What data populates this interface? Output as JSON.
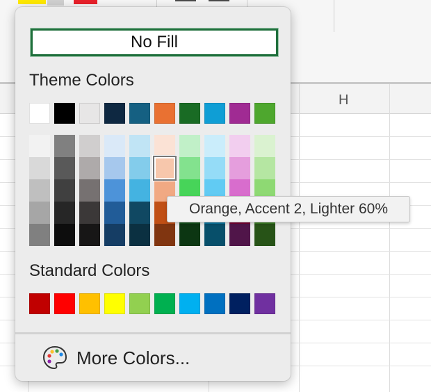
{
  "sheet": {
    "column_label": "H"
  },
  "popup": {
    "no_fill_label": "No Fill",
    "theme_title": "Theme Colors",
    "standard_title": "Standard Colors",
    "more_colors_label": "More Colors...",
    "theme_colors": [
      "#ffffff",
      "#000000",
      "#e7e6e6",
      "#0e2841",
      "#156082",
      "#e97132",
      "#196b24",
      "#0f9ed5",
      "#a02b93",
      "#4ea72e"
    ],
    "theme_tints": [
      [
        "#f2f2f2",
        "#d9d9d9",
        "#bfbfbf",
        "#a6a6a6",
        "#808080"
      ],
      [
        "#808080",
        "#595959",
        "#404040",
        "#262626",
        "#0d0d0d"
      ],
      [
        "#d0cece",
        "#aeaaaa",
        "#767171",
        "#3b3838",
        "#171616"
      ],
      [
        "#dae9f8",
        "#a6c8ed",
        "#4d93d9",
        "#215c98",
        "#153d64"
      ],
      [
        "#c0e4f5",
        "#83cceb",
        "#44b3e1",
        "#104862",
        "#0b3041"
      ],
      [
        "#fbe2d5",
        "#f7c7ac",
        "#f1a983",
        "#c04f15",
        "#803510"
      ],
      [
        "#c1f0c8",
        "#83e28e",
        "#47d459",
        "#12501b",
        "#0c3612"
      ],
      [
        "#caedfb",
        "#95dcf7",
        "#61cbf3",
        "#0b76a0",
        "#074f6a"
      ],
      [
        "#f2ceef",
        "#e59edd",
        "#d86dcd",
        "#780032",
        "#501549"
      ],
      [
        "#daf2d0",
        "#b5e6a2",
        "#8ed973",
        "#3b7d23",
        "#275317"
      ]
    ],
    "selected_tint": {
      "column": 5,
      "row": 1,
      "name": "Orange, Accent 2, Lighter 60%"
    },
    "standard_colors": [
      "#c00000",
      "#ff0000",
      "#ffc000",
      "#ffff00",
      "#92d050",
      "#00b050",
      "#00b0f0",
      "#0070c0",
      "#002060",
      "#7030a0"
    ]
  },
  "tooltip": {
    "text": "Orange, Accent 2, Lighter 60%"
  }
}
